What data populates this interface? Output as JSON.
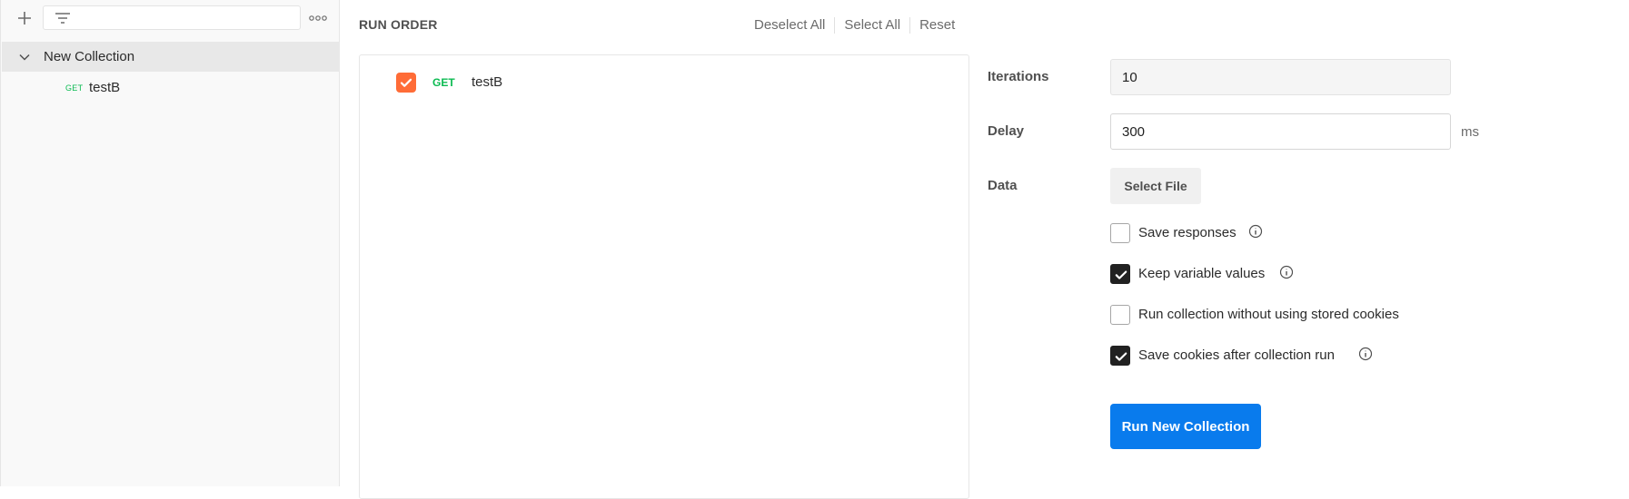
{
  "sidebar": {
    "search_placeholder": "",
    "collection": {
      "name": "New Collection"
    },
    "request": {
      "method": "GET",
      "name": "testB"
    }
  },
  "run_order": {
    "title": "RUN ORDER",
    "actions": {
      "deselect_all": "Deselect All",
      "select_all": "Select All",
      "reset": "Reset"
    },
    "items": [
      {
        "method": "GET",
        "name": "testB",
        "checked": true
      }
    ]
  },
  "settings": {
    "iterations": {
      "label": "Iterations",
      "value": "10"
    },
    "delay": {
      "label": "Delay",
      "value": "300",
      "unit": "ms"
    },
    "data": {
      "label": "Data",
      "button": "Select File"
    },
    "options": [
      {
        "label": "Save responses",
        "checked": false,
        "info": true
      },
      {
        "label": "Keep variable values",
        "checked": true,
        "info": true
      },
      {
        "label": "Run collection without using stored cookies",
        "checked": false,
        "info": false
      },
      {
        "label": "Save cookies after collection run",
        "checked": true,
        "info": true
      }
    ],
    "run_button": "Run New Collection"
  },
  "colors": {
    "accent": "#ff6c37",
    "primary": "#097bed",
    "method_get": "#0cbb52"
  }
}
